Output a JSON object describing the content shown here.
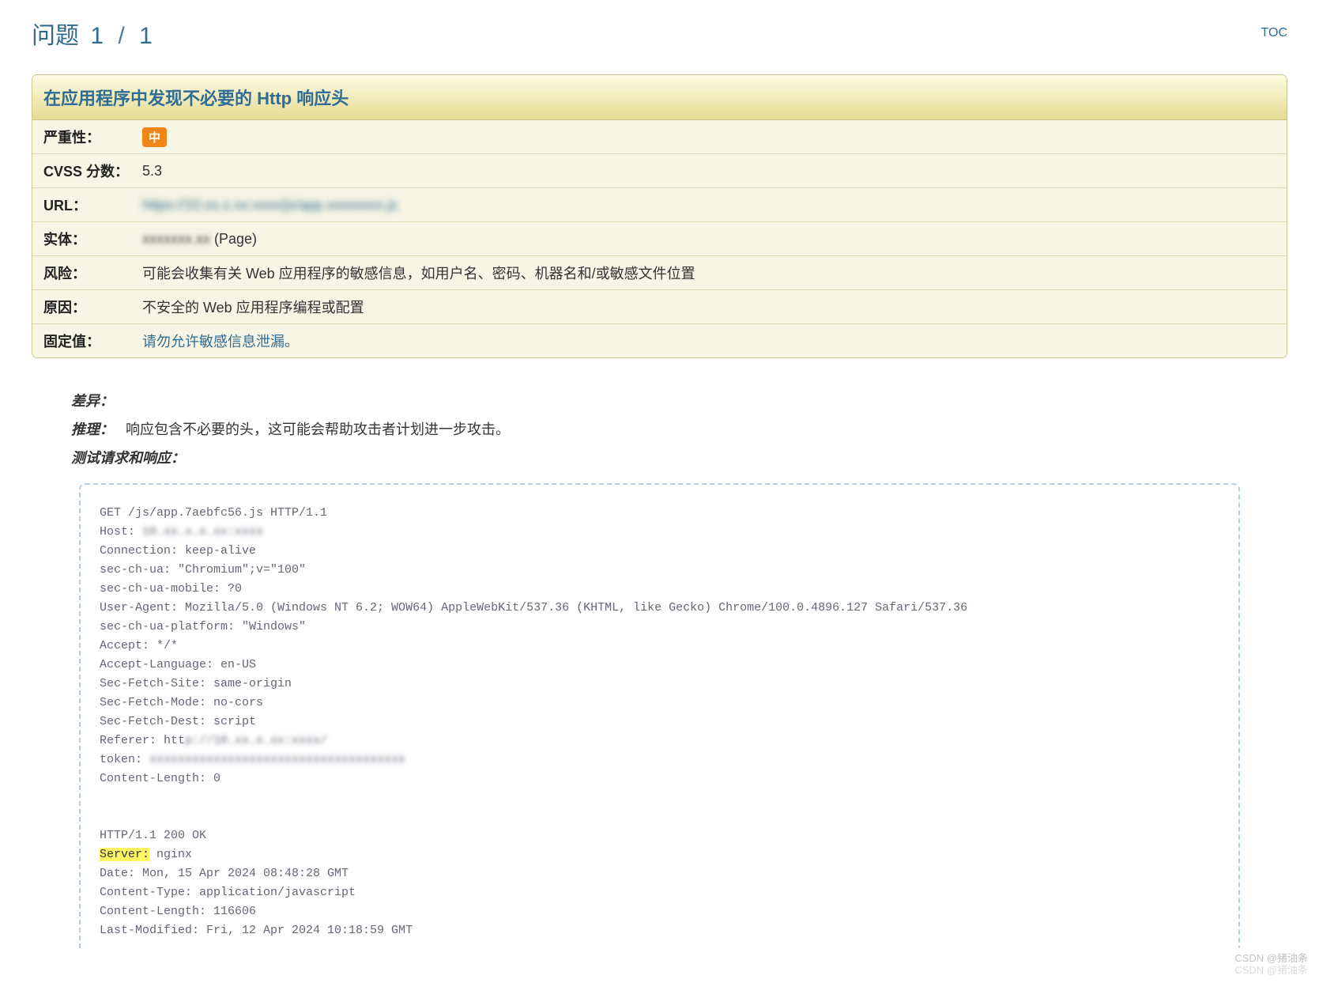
{
  "header": {
    "label": "问题",
    "current": "1",
    "total": "1",
    "toc": "TOC"
  },
  "issue": {
    "title": "在应用程序中发现不必要的 Http 响应头",
    "rows": {
      "severity_label": "严重性：",
      "severity_value": "中",
      "cvss_label": "CVSS 分数：",
      "cvss_value": "5.3",
      "url_label": "URL：",
      "url_value": "https://10.xx.x.xx:xxxx/js/app.xxxxxxxx.js",
      "entity_label": "实体：",
      "entity_value_blur": "xxxxxxx.xx",
      "entity_value_tail": " (Page)",
      "risk_label": "风险：",
      "risk_value": "可能会收集有关 Web 应用程序的敏感信息，如用户名、密码、机器名和/或敏感文件位置",
      "cause_label": "原因：",
      "cause_value": "不安全的 Web 应用程序编程或配置",
      "fix_label": "固定值：",
      "fix_value": "请勿允许敏感信息泄漏。"
    }
  },
  "details": {
    "diff_label": "差异：",
    "infer_label": "推理：",
    "infer_value": "响应包含不必要的头，这可能会帮助攻击者计划进一步攻击。",
    "reqres_label": "测试请求和响应："
  },
  "http": {
    "req_line": "GET /js/app.7aebfc56.js HTTP/1.1",
    "host_label": "Host: ",
    "host_value": "10.xx.x.x.xx:xxxx",
    "conn": "Connection: keep-alive",
    "sec_ua": "sec-ch-ua: \"Chromium\";v=\"100\"",
    "sec_ua_mobile": "sec-ch-ua-mobile: ?0",
    "user_agent": "User-Agent: Mozilla/5.0 (Windows NT 6.2; WOW64) AppleWebKit/537.36 (KHTML, like Gecko) Chrome/100.0.4896.127 Safari/537.36",
    "sec_platform": "sec-ch-ua-platform: \"Windows\"",
    "accept": "Accept: */*",
    "accept_lang": "Accept-Language: en-US",
    "sec_site": "Sec-Fetch-Site: same-origin",
    "sec_mode": "Sec-Fetch-Mode: no-cors",
    "sec_dest": "Sec-Fetch-Dest: script",
    "referer_label": "Referer: htt",
    "referer_value": "p://10.xx.x.xx:xxxx/",
    "token_label": "token: ",
    "token_value": "xxxxxxxxxxxxxxxxxxxxxxxxxxxxxxxxxxxx",
    "cl_req": "Content-Length: 0",
    "status": "HTTP/1.1 200 OK",
    "server_label": "Server:",
    "server_value": " nginx",
    "date": "Date: Mon, 15 Apr 2024 08:48:28 GMT",
    "ctype": "Content-Type: application/javascript",
    "clen": "Content-Length: 116606",
    "lastmod": "Last-Modified: Fri, 12 Apr 2024 10:18:59 GMT"
  },
  "watermark": {
    "l1": "CSDN @猪油条",
    "l2": "CSDN @猪油条"
  }
}
